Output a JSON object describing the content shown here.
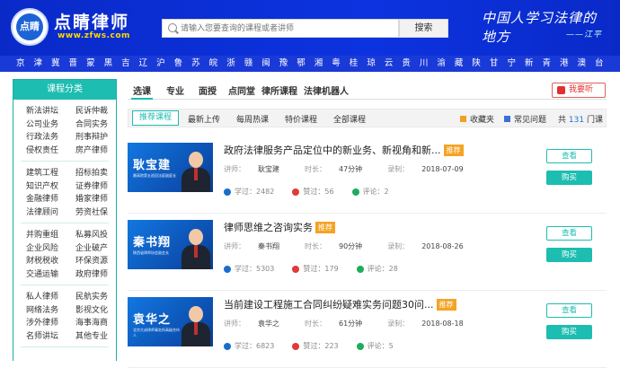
{
  "header": {
    "logo_text": "点睛",
    "brand": "点睛律师",
    "url": "www.zfws.com",
    "search_placeholder": "请输入您要查询的课程或者讲师",
    "search_button": "搜索",
    "slogan": "中国人学习法律的地方",
    "slogan_signature": "——江平"
  },
  "cities": [
    "京",
    "津",
    "冀",
    "晋",
    "蒙",
    "黑",
    "吉",
    "辽",
    "沪",
    "鲁",
    "苏",
    "皖",
    "浙",
    "赣",
    "闽",
    "豫",
    "鄂",
    "湘",
    "粤",
    "桂",
    "琼",
    "云",
    "贵",
    "川",
    "渝",
    "藏",
    "陕",
    "甘",
    "宁",
    "新",
    "青",
    "港",
    "澳",
    "台"
  ],
  "sidebar": {
    "title": "课程分类",
    "groups": [
      [
        [
          "新法讲坛",
          "民诉仲裁"
        ],
        [
          "公司业务",
          "合同实务"
        ],
        [
          "行政法务",
          "刑事辩护"
        ],
        [
          "侵权责任",
          "房产律师"
        ]
      ],
      [
        [
          "建筑工程",
          "招标拍卖"
        ],
        [
          "知识产权",
          "证券律师"
        ],
        [
          "金融律师",
          "婚家律师"
        ],
        [
          "法律顾问",
          "劳资社保"
        ]
      ],
      [
        [
          "并购重组",
          "私募风投"
        ],
        [
          "企业风险",
          "企业破产"
        ],
        [
          "财税税收",
          "环保资源"
        ],
        [
          "交通运输",
          "政府律师"
        ]
      ],
      [
        [
          "私人律师",
          "民航实务"
        ],
        [
          "网络法务",
          "影视文化"
        ],
        [
          "涉外律师",
          "海事海商"
        ],
        [
          "名师讲坛",
          "其他专业"
        ]
      ]
    ]
  },
  "tabs": [
    "选课",
    "专业",
    "面授",
    "点同堂",
    "律所课程",
    "法律机器人"
  ],
  "want_listen": "我要听",
  "subtabs": [
    "推荐课程",
    "最新上传",
    "每周热课",
    "特价课程",
    "全部课程"
  ],
  "favorites": "收藏夹",
  "faq": "常见问题",
  "count": {
    "prefix": "共",
    "num": "131",
    "suffix": "门课"
  },
  "labels": {
    "lecturer": "讲师：",
    "duration": "时长：",
    "recorded": "录制：",
    "learned": "学过：",
    "liked": "赞过：",
    "comments": "评论：",
    "view": "查看",
    "buy": "购买",
    "recommend": "推荐"
  },
  "courses": [
    {
      "title": "政府法律服务产品定位中的新业务、新视角和新...",
      "thumb_name": "耿宝建",
      "thumb_org": "最高院第五巡回法庭副庭长",
      "lecturer": "耿宝建",
      "duration": "47分钟",
      "recorded": "2018-07-09",
      "learned": "2482",
      "liked": "56",
      "comments": "2"
    },
    {
      "title": "律师思维之咨询实务",
      "thumb_name": "秦书翔",
      "thumb_org": "陕西省律师协会副会长",
      "lecturer": "秦书翔",
      "duration": "90分钟",
      "recorded": "2018-08-26",
      "learned": "5303",
      "liked": "179",
      "comments": "28"
    },
    {
      "title": "当前建设工程施工合同纠纷疑难实务问题30问...",
      "thumb_name": "袁华之",
      "thumb_org": "北京大成律师事务所高级合伙人",
      "lecturer": "袁华之",
      "duration": "61分钟",
      "recorded": "2018-08-18",
      "learned": "6823",
      "liked": "223",
      "comments": "5"
    }
  ]
}
